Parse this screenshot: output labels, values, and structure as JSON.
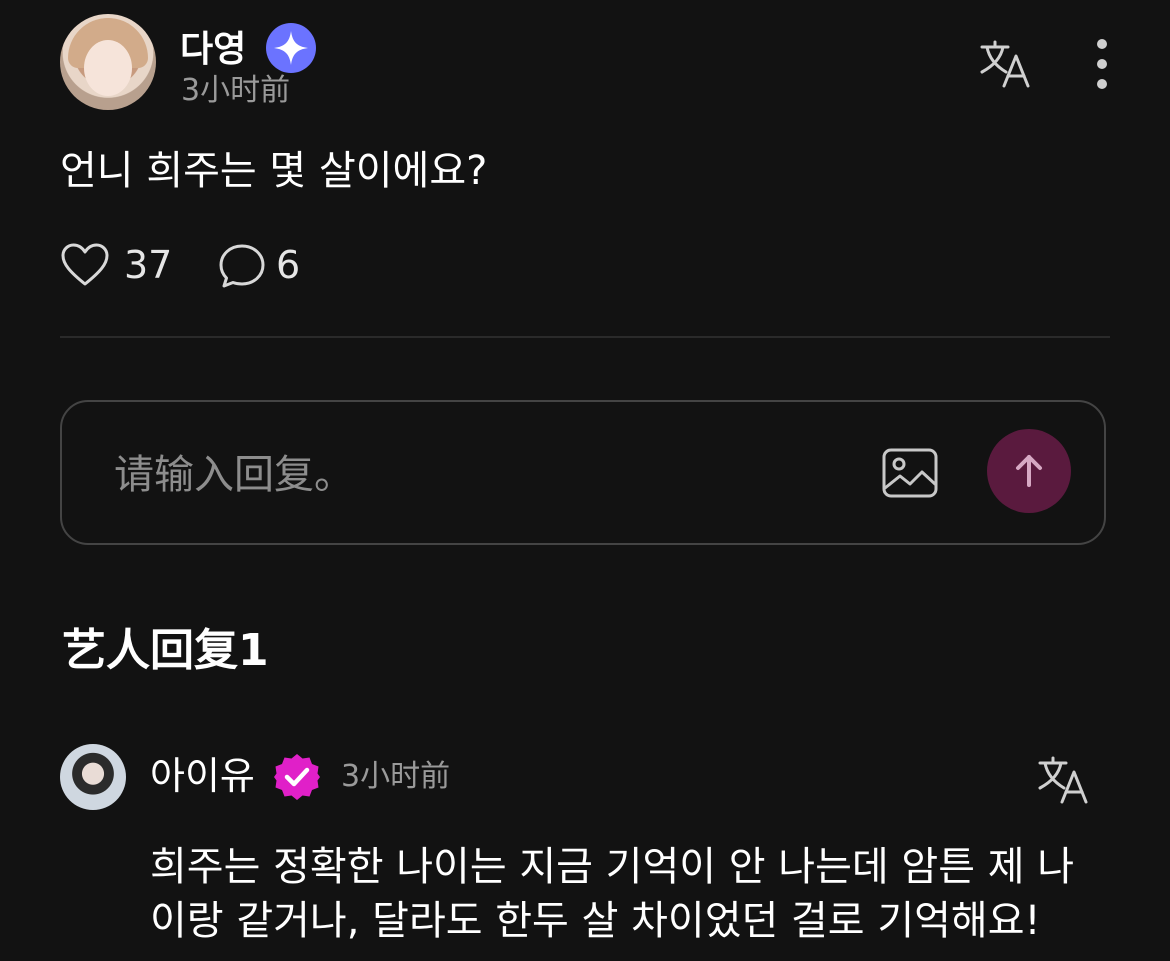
{
  "post": {
    "author": "다영",
    "time": "3小时前",
    "body": "언니 희주는 몇 살이에요?",
    "likes": "37",
    "comments": "6"
  },
  "reply_box": {
    "placeholder": "请输入回复。"
  },
  "artist_replies": {
    "title": "艺人回复1",
    "items": [
      {
        "author": "아이유",
        "time": "3小时前",
        "text": "희주는 정확한 나이는 지금 기억이 안 나는데 암튼 제 나이랑 같거나, 달라도 한두 살 차이었던 걸로 기억해요!"
      }
    ]
  },
  "colors": {
    "background": "#121212",
    "verified_blue": "#6b73ff",
    "verified_pink": "#e020c8",
    "send_button": "#5a1a3e",
    "muted_text": "#9a9a9a"
  },
  "icons": {
    "verified_author": "sparkle-badge-icon",
    "verified_artist": "check-badge-icon",
    "translate": "translate-icon",
    "more": "more-vertical-icon",
    "like": "heart-icon",
    "comment": "comment-bubble-icon",
    "image": "image-icon",
    "send": "arrow-up-icon"
  }
}
